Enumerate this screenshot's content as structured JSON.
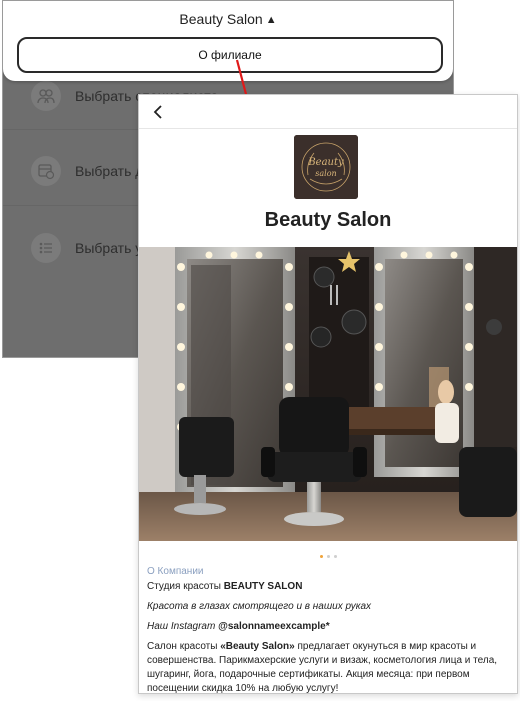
{
  "back_screen": {
    "branch_title": "Beauty Salon",
    "about_button": "О филиале",
    "menu": [
      {
        "label": "Выбрать специалиста",
        "icon": "people-icon"
      },
      {
        "label": "Выбрать дату и время",
        "icon": "calendar-clock-icon"
      },
      {
        "label": "Выбрать услуги",
        "icon": "list-icon"
      }
    ]
  },
  "card": {
    "back_icon": "back-arrow-icon",
    "logo_text_1": "Beauty",
    "logo_text_2": "salon",
    "salon_name": "Beauty Salon",
    "carousel": {
      "pages": 3,
      "active": 0
    },
    "about_heading": "О Компании",
    "studio_prefix": "Студия красоты ",
    "studio_name": "BEAUTY SALON",
    "slogan": "Красота в глазах смотрящего и в наших руках",
    "instagram_prefix": "Наш Instagram ",
    "instagram_handle": "@salonnameexcample*",
    "desc_prefix": "Салон красоты ",
    "desc_name": "«Beauty Salon»",
    "desc_rest": " предлагает окунуться в мир красоты и совершенства. Парикмахерские услуги и визаж, косметология лица и тела, шугаринг, йога, подарочные сертификаты. Акция месяца: при первом посещении скидка 10% на любую услугу!"
  },
  "colors": {
    "accent_arrow": "#e01a1a",
    "dot_active": "#f0a33a",
    "about_heading": "#8a9fbf",
    "overlay": "#6e6e6e"
  }
}
